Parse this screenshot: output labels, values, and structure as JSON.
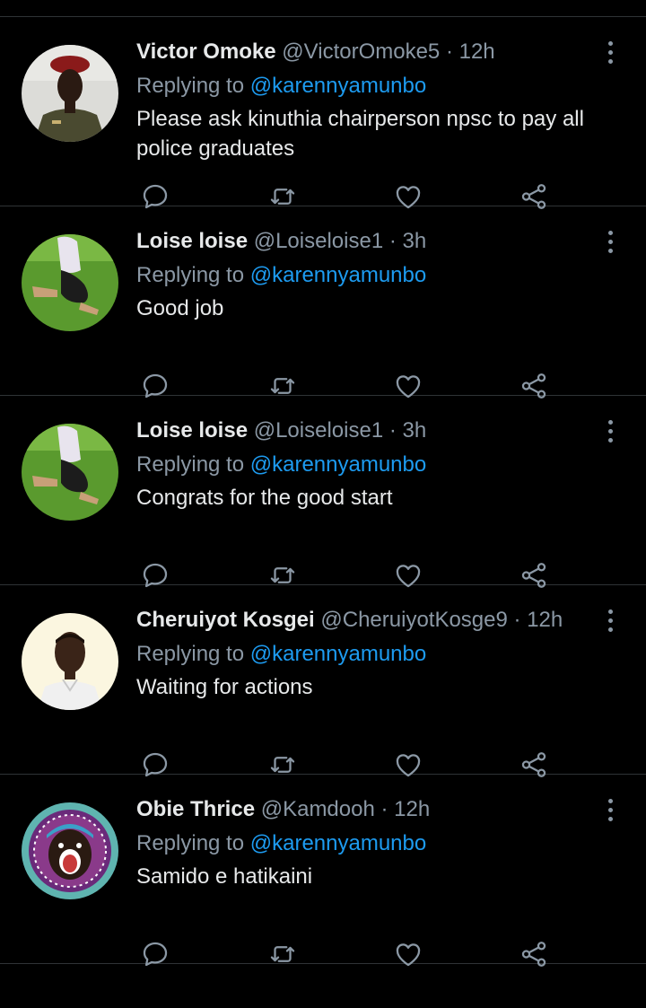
{
  "replies": [
    {
      "name": "Victor Omoke",
      "handle": "@VictorOmoke5",
      "sep": " · ",
      "time": "12h",
      "replying_prefix": "Replying to ",
      "replying_to": "@karennyamunbo",
      "text": "Please ask kinuthia chairperson npsc to pay all police graduates",
      "avatar": "avatar-man-red-beret"
    },
    {
      "name": "Loise loise",
      "handle": "@Loiseloise1",
      "sep": " · ",
      "time": "3h",
      "replying_prefix": "Replying to ",
      "replying_to": "@karennyamunbo",
      "text": "Good job",
      "avatar": "avatar-woman-on-grass"
    },
    {
      "name": "Loise loise",
      "handle": "@Loiseloise1",
      "sep": " · ",
      "time": "3h",
      "replying_prefix": "Replying to ",
      "replying_to": "@karennyamunbo",
      "text": "Congrats for the good start",
      "avatar": "avatar-woman-on-grass"
    },
    {
      "name": "Cheruiyot Kosgei",
      "handle": "@CheruiyotKosge9",
      "sep": " · ",
      "time": "12h",
      "replying_prefix": "Replying to ",
      "replying_to": "@karennyamunbo",
      "text": "Waiting for actions",
      "avatar": "avatar-man-white-background"
    },
    {
      "name": "Obie Thrice",
      "handle": "@Kamdooh",
      "sep": " · ",
      "time": "12h",
      "replying_prefix": "Replying to ",
      "replying_to": "@karennyamunbo",
      "text": "Samido e hatikaini",
      "avatar": "avatar-cartoon-shouting"
    }
  ],
  "icons": {
    "more": "more-vertical-icon",
    "reply": "reply-bubble-icon",
    "retweet": "retweet-icon",
    "like": "heart-icon",
    "share": "share-icon"
  },
  "colors": {
    "background": "#000000",
    "primary_text": "#e7e9ea",
    "secondary_text": "#8b98a5",
    "accent": "#1d9bf0",
    "divider": "#2f3336"
  }
}
